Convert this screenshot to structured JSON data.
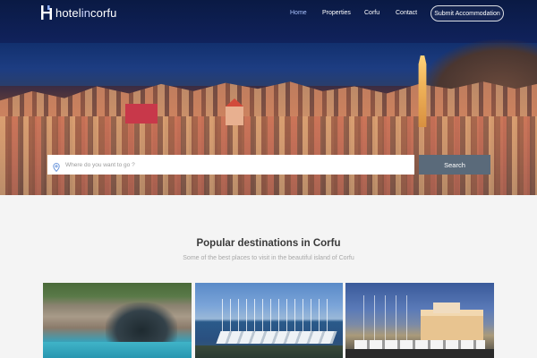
{
  "brand": {
    "name_prefix": "hotel",
    "name_mid": "in",
    "name_suffix": "corfu"
  },
  "nav": {
    "items": [
      {
        "label": "Home",
        "active": true
      },
      {
        "label": "Properties",
        "active": false
      },
      {
        "label": "Corfu",
        "active": false
      },
      {
        "label": "Contact",
        "active": false
      }
    ],
    "submit_label": "Submit Accommodation"
  },
  "search": {
    "placeholder": "Where do you want to go ?",
    "button_label": "Search"
  },
  "destinations": {
    "title": "Popular destinations in Corfu",
    "subtitle": "Some of the best places to visit in the beautiful island of Corfu"
  },
  "colors": {
    "accent": "#5a6a7a",
    "nav_active": "#aac2ff",
    "hero_dark": "#0a1a44"
  },
  "icons": {
    "logo": "hotel-logo-icon",
    "search": "map-pin-icon"
  }
}
